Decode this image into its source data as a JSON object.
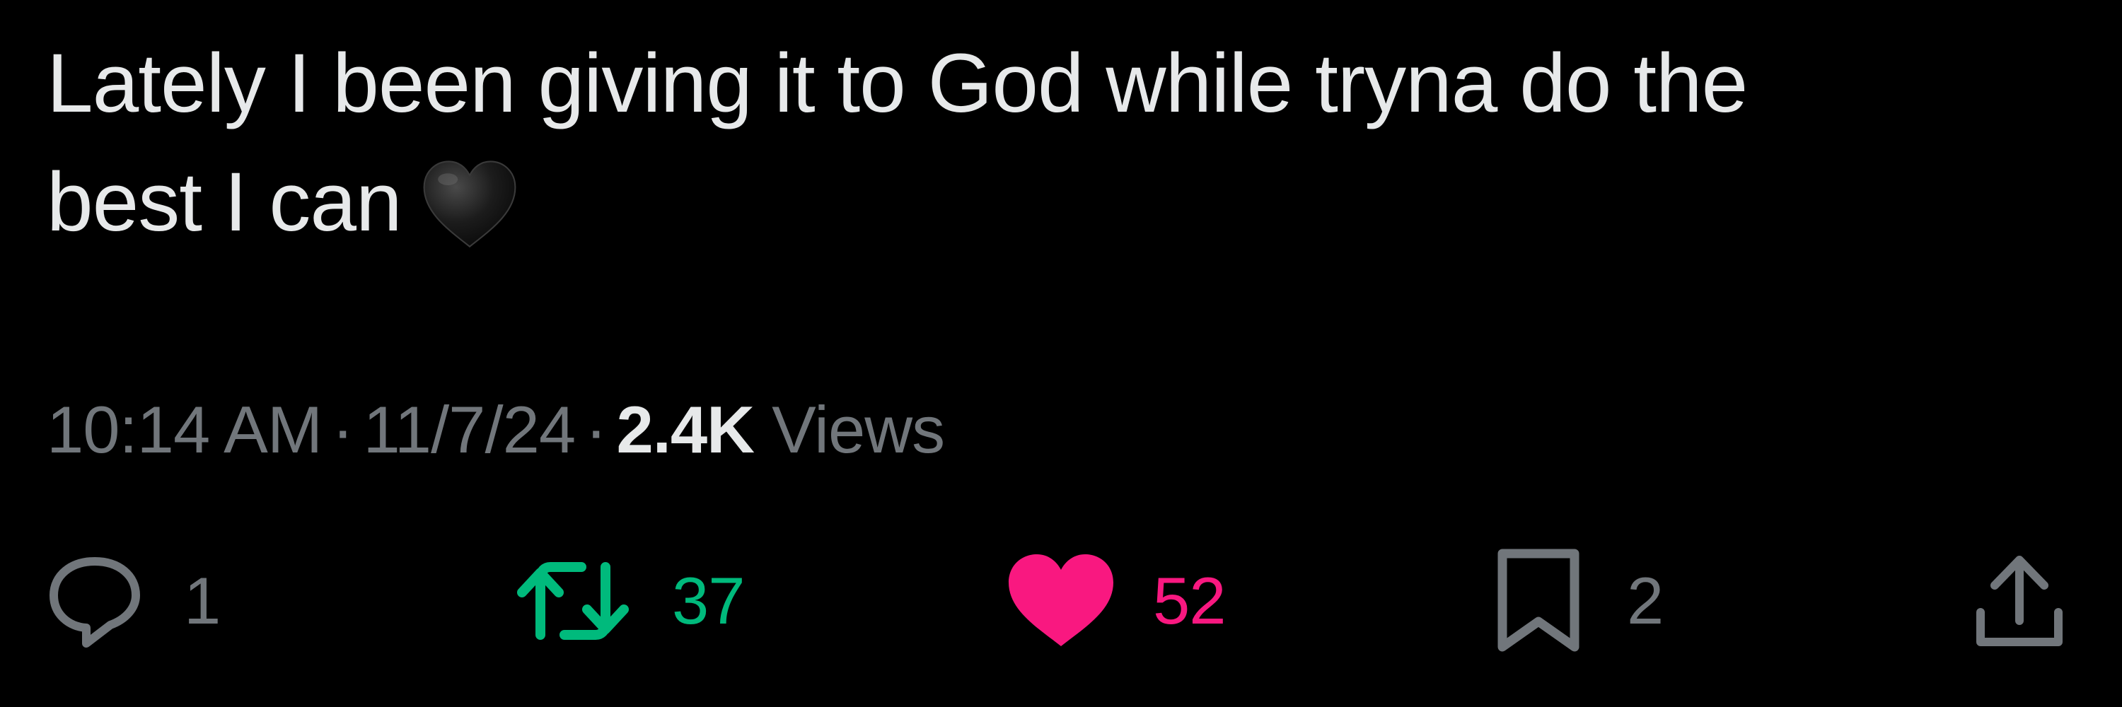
{
  "tweet": {
    "text_line1": "Lately I been giving it to God while tryna do the",
    "text_line2": "best I can",
    "emoji": "black-heart"
  },
  "meta": {
    "time": "10:14 AM",
    "separator": "·",
    "date": "11/7/24",
    "views_count": "2.4K",
    "views_label": "Views"
  },
  "actions": {
    "reply": {
      "count": "1",
      "icon": "reply-icon"
    },
    "repost": {
      "count": "37",
      "icon": "repost-icon"
    },
    "like": {
      "count": "52",
      "icon": "heart-icon"
    },
    "bookmark": {
      "count": "2",
      "icon": "bookmark-icon"
    },
    "share": {
      "icon": "share-icon"
    }
  },
  "colors": {
    "background": "#000000",
    "text_primary": "#e7e9ea",
    "text_secondary": "#71767b",
    "repost_active": "#00ba7c",
    "like_active": "#f91880"
  }
}
